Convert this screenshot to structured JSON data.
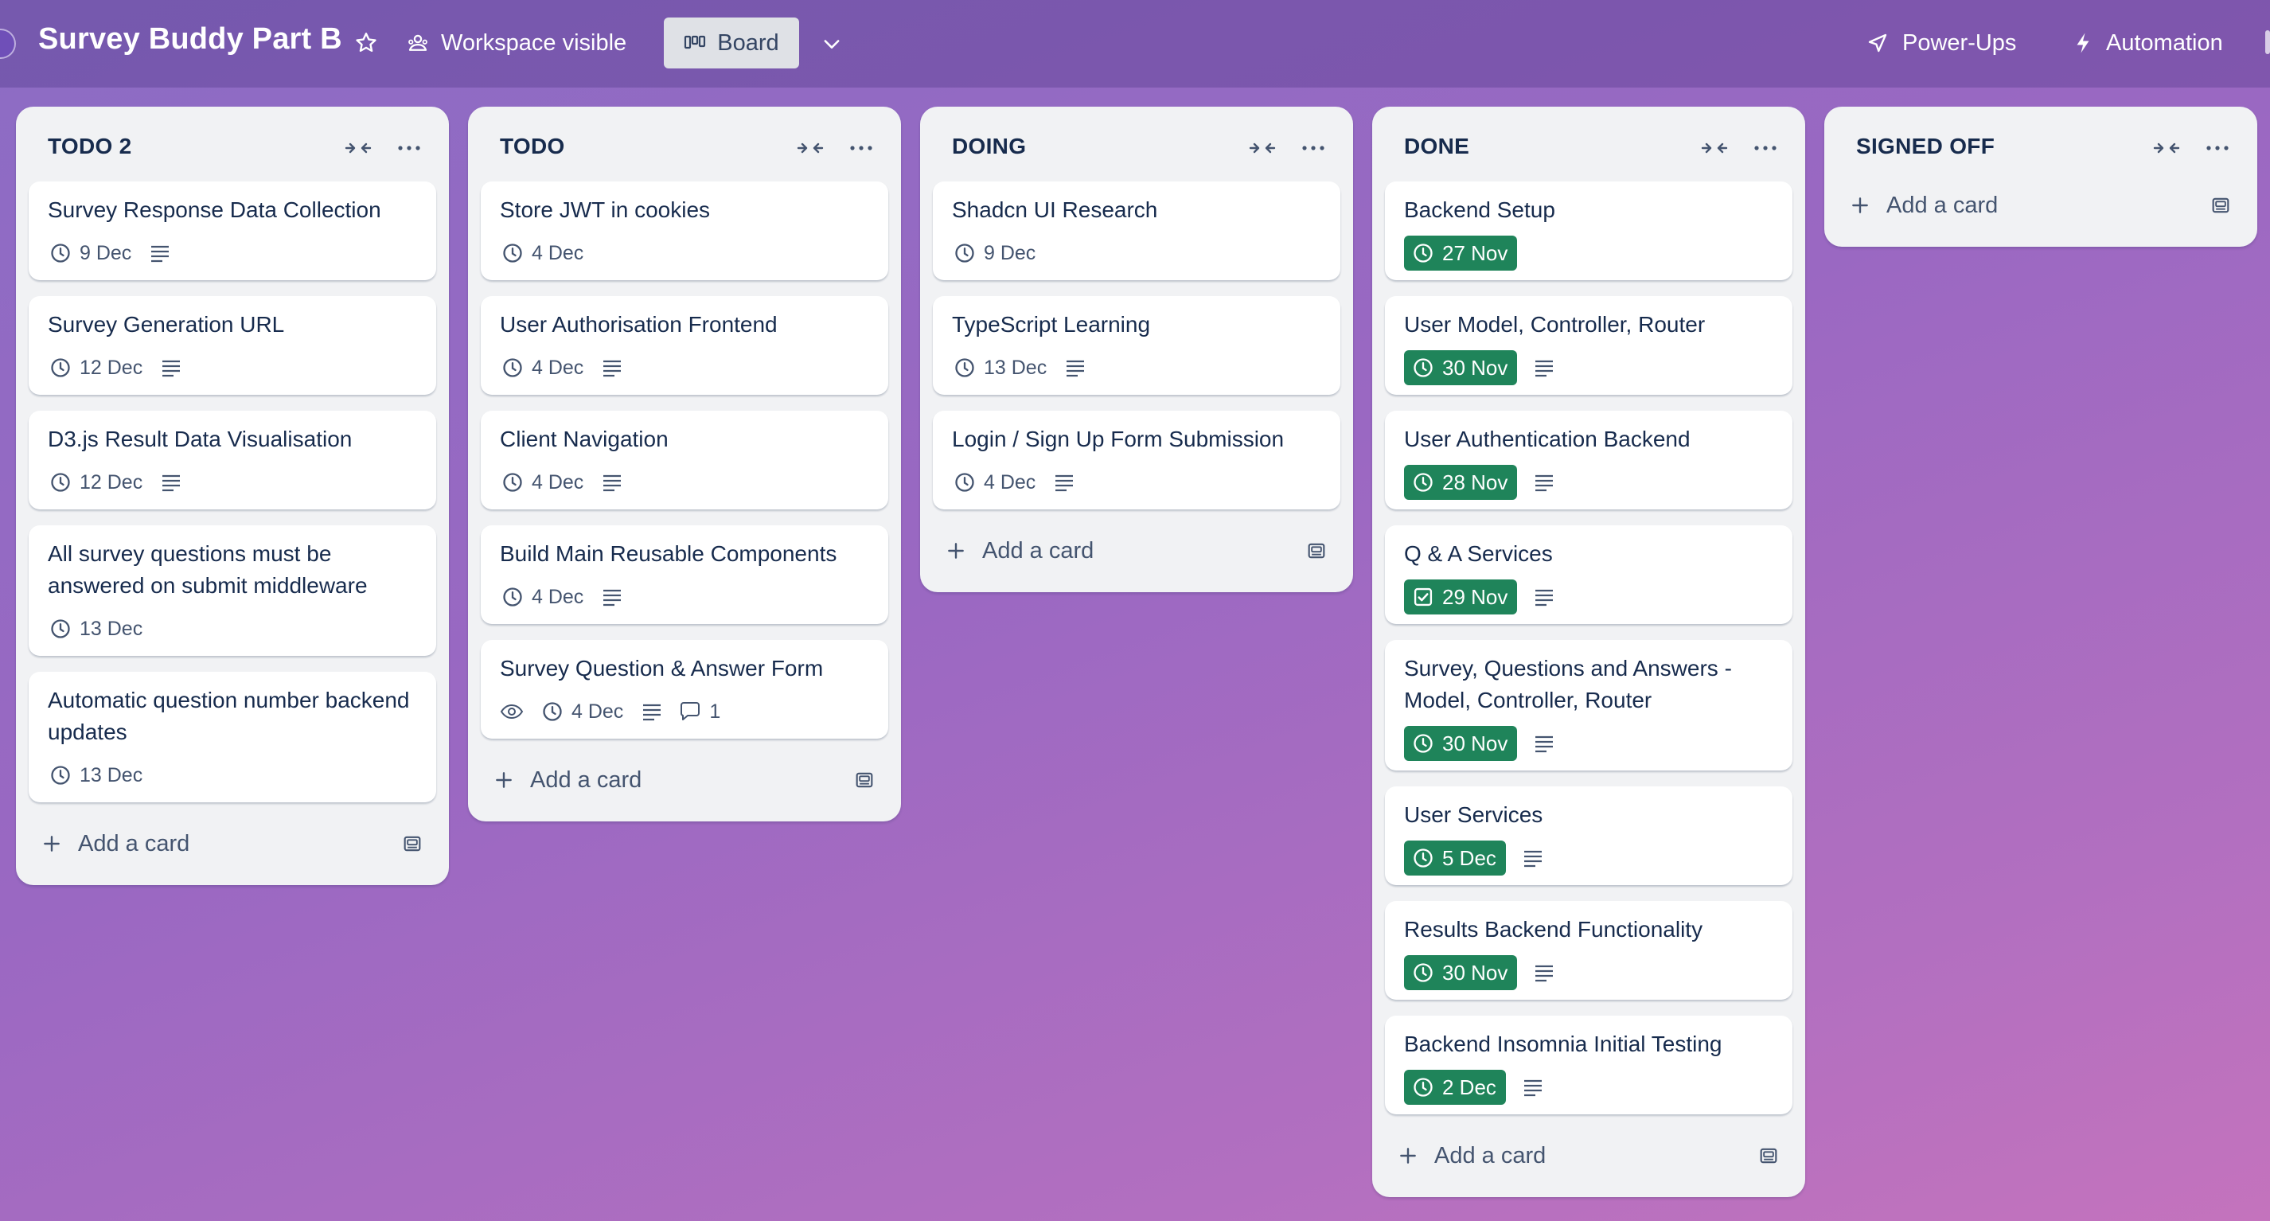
{
  "header": {
    "title": "Survey Buddy Part B",
    "visibility_label": "Workspace visible",
    "view_label": "Board",
    "powerups_label": "Power-Ups",
    "automation_label": "Automation"
  },
  "colors": {
    "due_complete": "#1f845a",
    "list_bg": "#f1f2f4",
    "card_bg": "#ffffff",
    "text_primary": "#172b4d",
    "text_secondary": "#44546f"
  },
  "icons": [
    "star-icon",
    "workspace-icon",
    "board-icon",
    "chevron-down-icon",
    "rocket-icon",
    "bolt-icon",
    "collapse-icon",
    "more-icon",
    "clock-icon",
    "checkbox-icon",
    "description-icon",
    "eye-icon",
    "comment-icon",
    "plus-icon",
    "template-icon"
  ],
  "add_card_label": "Add a card",
  "lists": [
    {
      "title": "TODO 2",
      "cards": [
        {
          "title": "Survey Response Data Collection",
          "due": "9 Dec"
        },
        {
          "title": "Survey Generation URL",
          "due": "12 Dec"
        },
        {
          "title": "D3.js Result Data Visualisation",
          "due": "12 Dec"
        },
        {
          "title": "All survey questions must be answered on submit middleware",
          "due": "13 Dec"
        },
        {
          "title": "Automatic question number backend updates",
          "due": "13 Dec"
        }
      ]
    },
    {
      "title": "TODO",
      "cards": [
        {
          "title": "Store JWT in cookies",
          "due": "4 Dec"
        },
        {
          "title": "User Authorisation Frontend",
          "due": "4 Dec"
        },
        {
          "title": "Client Navigation",
          "due": "4 Dec"
        },
        {
          "title": "Build Main Reusable Components",
          "due": "4 Dec"
        },
        {
          "title": "Survey Question & Answer Form",
          "due": "4 Dec",
          "comments": "1"
        }
      ]
    },
    {
      "title": "DOING",
      "cards": [
        {
          "title": "Shadcn UI Research",
          "due": "9 Dec"
        },
        {
          "title": "TypeScript Learning",
          "due": "13 Dec"
        },
        {
          "title": "Login / Sign Up Form Submission",
          "due": "4 Dec"
        }
      ]
    },
    {
      "title": "DONE",
      "cards": [
        {
          "title": "Backend Setup",
          "due": "27 Nov"
        },
        {
          "title": "User Model, Controller, Router",
          "due": "30 Nov"
        },
        {
          "title": "User Authentication Backend",
          "due": "28 Nov"
        },
        {
          "title": "Q & A Services",
          "due": "29 Nov"
        },
        {
          "title": "Survey, Questions and Answers - Model, Controller, Router",
          "due": "30 Nov"
        },
        {
          "title": "User Services",
          "due": "5 Dec"
        },
        {
          "title": "Results Backend Functionality",
          "due": "30 Nov"
        },
        {
          "title": "Backend Insomnia Initial Testing",
          "due": "2 Dec"
        }
      ]
    },
    {
      "title": "SIGNED OFF",
      "cards": []
    }
  ]
}
